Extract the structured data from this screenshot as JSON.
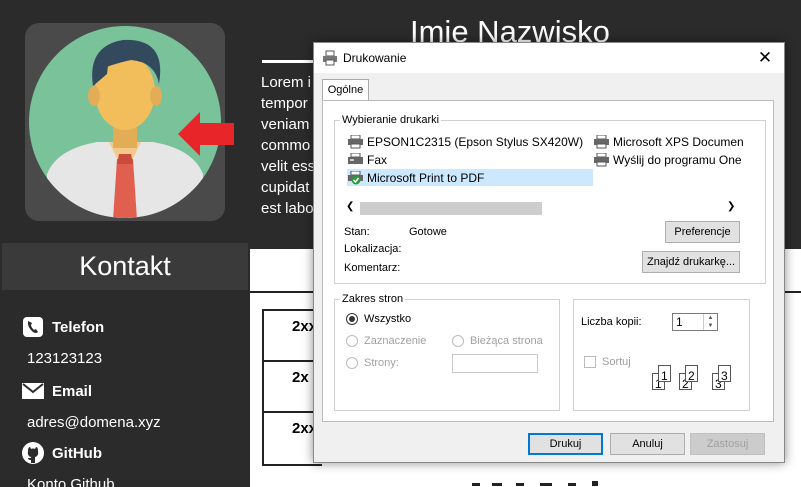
{
  "cv": {
    "name": "Imie Nazwisko",
    "lorem_lines": [
      "Lorem i",
      "tempor",
      "veniam",
      "commo",
      "velit ess",
      "cupidat",
      "est labo"
    ],
    "sidebar": {
      "contact_header": "Kontakt",
      "phone_label": "Telefon",
      "phone_value": "123123123",
      "email_label": "Email",
      "email_value": "adres@domena.xyz",
      "github_label": "GitHub",
      "github_value": "Konto Github"
    },
    "table_cells": [
      "2xx",
      "2x",
      "2xx"
    ]
  },
  "dialog": {
    "title": "Drukowanie",
    "close_glyph": "✕",
    "tab": "Ogólne",
    "printer_group_label": "Wybieranie drukarki",
    "printers": [
      {
        "name": "EPSON1C2315 (Epson Stylus SX420W)",
        "icon": "printer-icon",
        "selected": false
      },
      {
        "name": "Fax",
        "icon": "fax-icon",
        "selected": false
      },
      {
        "name": "Microsoft Print to PDF",
        "icon": "default-printer-icon",
        "selected": true
      },
      {
        "name": "Microsoft XPS Documen",
        "icon": "printer-icon",
        "selected": false
      },
      {
        "name": "Wyślij do programu One",
        "icon": "printer-icon",
        "selected": false
      }
    ],
    "status_label": "Stan:",
    "status_value": "Gotowe",
    "location_label": "Lokalizacja:",
    "comment_label": "Komentarz:",
    "preferences_button": "Preferencje",
    "find_printer_button": "Znajdź drukarkę...",
    "page_range_group_label": "Zakres stron",
    "range_all": "Wszystko",
    "range_selection": "Zaznaczenie",
    "range_current": "Bieżąca strona",
    "range_pages": "Strony:",
    "copies_label": "Liczba kopii:",
    "copies_value": "1",
    "collate_label": "Sortuj",
    "collate_pages": [
      "1",
      "1",
      "2",
      "2",
      "3",
      "3"
    ],
    "print_button": "Drukuj",
    "cancel_button": "Anuluj",
    "apply_button": "Zastosuj"
  },
  "colors": {
    "accent": "#0078d7",
    "selection": "#cce8ff",
    "arrow": "#e8262a",
    "sidebar_bg": "#2b2b2b"
  }
}
